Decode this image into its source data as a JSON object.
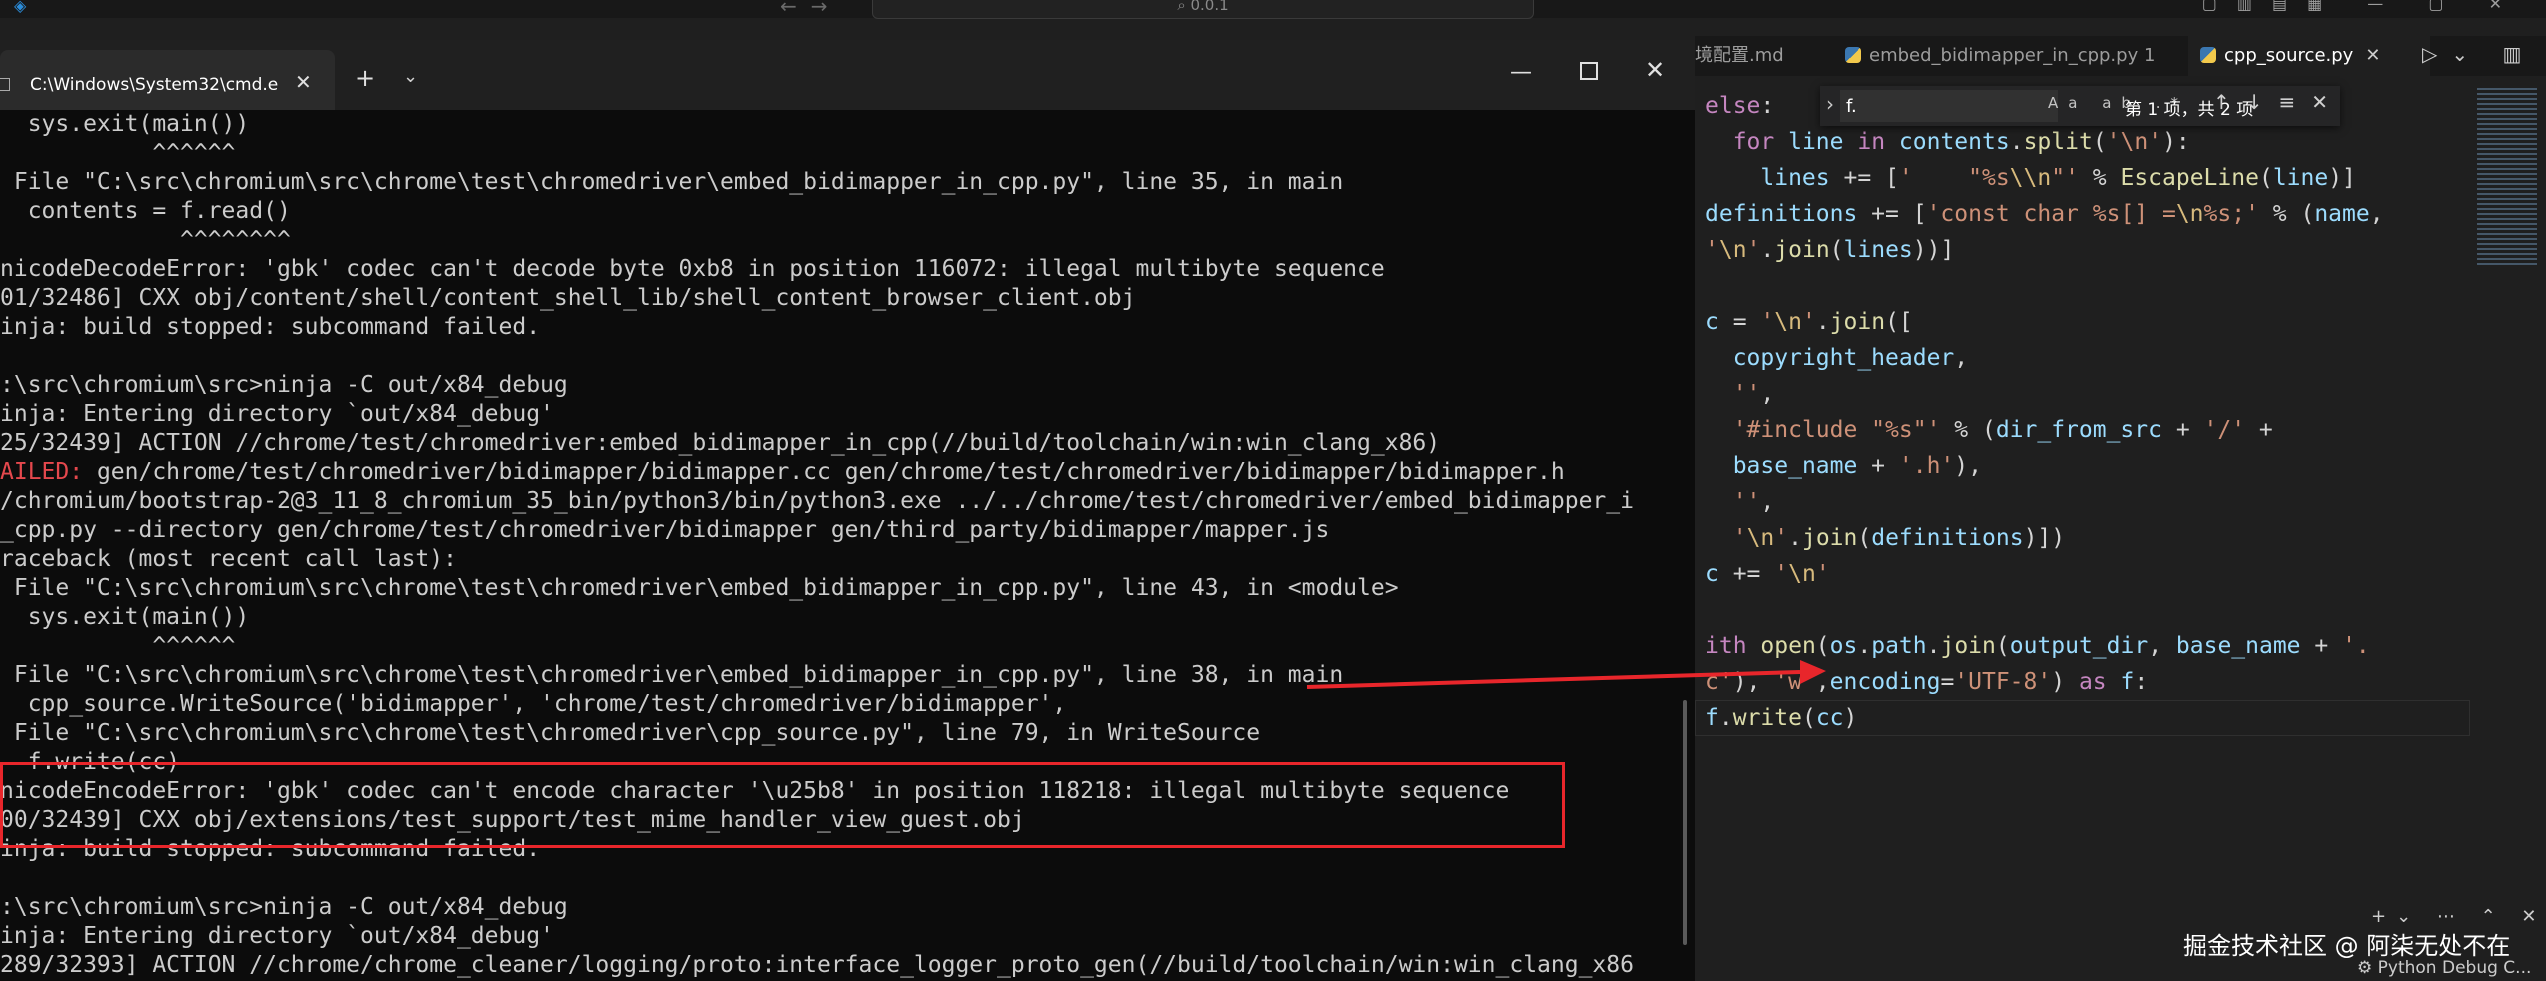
{
  "topbar": {
    "search_text": "0.0.1"
  },
  "terminal": {
    "tab_title": "C:\\Windows\\System32\\cmd.e",
    "lines": [
      "  sys.exit(main())",
      "           ^^^^^^",
      " File \"C:\\src\\chromium\\src\\chrome\\test\\chromedriver\\embed_bidimapper_in_cpp.py\", line 35, in main",
      "  contents = f.read()",
      "             ^^^^^^^^",
      "nicodeDecodeError: 'gbk' codec can't decode byte 0xb8 in position 116072: illegal multibyte sequence",
      "01/32486] CXX obj/content/shell/content_shell_lib/shell_content_browser_client.obj",
      "inja: build stopped: subcommand failed.",
      "",
      ":\\src\\chromium\\src>ninja -C out/x84_debug",
      "inja: Entering directory `out/x84_debug'",
      "25/32439] ACTION //chrome/test/chromedriver:embed_bidimapper_in_cpp(//build/toolchain/win:win_clang_x86)",
      "",
      "/chromium/bootstrap-2@3_11_8_chromium_35_bin/python3/bin/python3.exe ../../chrome/test/chromedriver/embed_bidimapper_i",
      "_cpp.py --directory gen/chrome/test/chromedriver/bidimapper gen/third_party/bidimapper/mapper.js",
      "raceback (most recent call last):",
      " File \"C:\\src\\chromium\\src\\chrome\\test\\chromedriver\\embed_bidimapper_in_cpp.py\", line 43, in <module>",
      "  sys.exit(main())",
      "           ^^^^^^",
      " File \"C:\\src\\chromium\\src\\chrome\\test\\chromedriver\\embed_bidimapper_in_cpp.py\", line 38, in main",
      "  cpp_source.WriteSource('bidimapper', 'chrome/test/chromedriver/bidimapper',",
      " File \"C:\\src\\chromium\\src\\chrome\\test\\chromedriver\\cpp_source.py\", line 79, in WriteSource",
      "  f.write(cc)",
      "nicodeEncodeError: 'gbk' codec can't encode character '\\u25b8' in position 118218: illegal multibyte sequence",
      "00/32439] CXX obj/extensions/test_support/test_mime_handler_view_guest.obj",
      "inja: build stopped: subcommand failed.",
      "",
      ":\\src\\chromium\\src>ninja -C out/x84_debug",
      "inja: Entering directory `out/x84_debug'",
      "289/32393] ACTION //chrome/chrome_cleaner/logging/proto:interface_logger_proto_gen(//build/toolchain/win:win_clang_x86"
    ],
    "failed_label": "AILED:",
    "failed_rest": " gen/chrome/test/chromedriver/bidimapper/bidimapper.cc gen/chrome/test/chromedriver/bidimapper/bidimapper.h"
  },
  "editor": {
    "tabs": [
      {
        "label": "境配置.md"
      },
      {
        "label": "embed_bidimapper_in_cpp.py 1"
      },
      {
        "label": "cpp_source.py"
      }
    ],
    "find": {
      "query": "f.",
      "count": "第 1 项，共 2 项",
      "opts": "Aa ab .*"
    },
    "watermark": "掘金技术社区 @ 阿柒无处不在",
    "status_text": "Python Debug C..."
  },
  "colors": {
    "highlight_box": "#e8262b",
    "arrow": "#e8262b",
    "failed_text": "#e5484d"
  }
}
